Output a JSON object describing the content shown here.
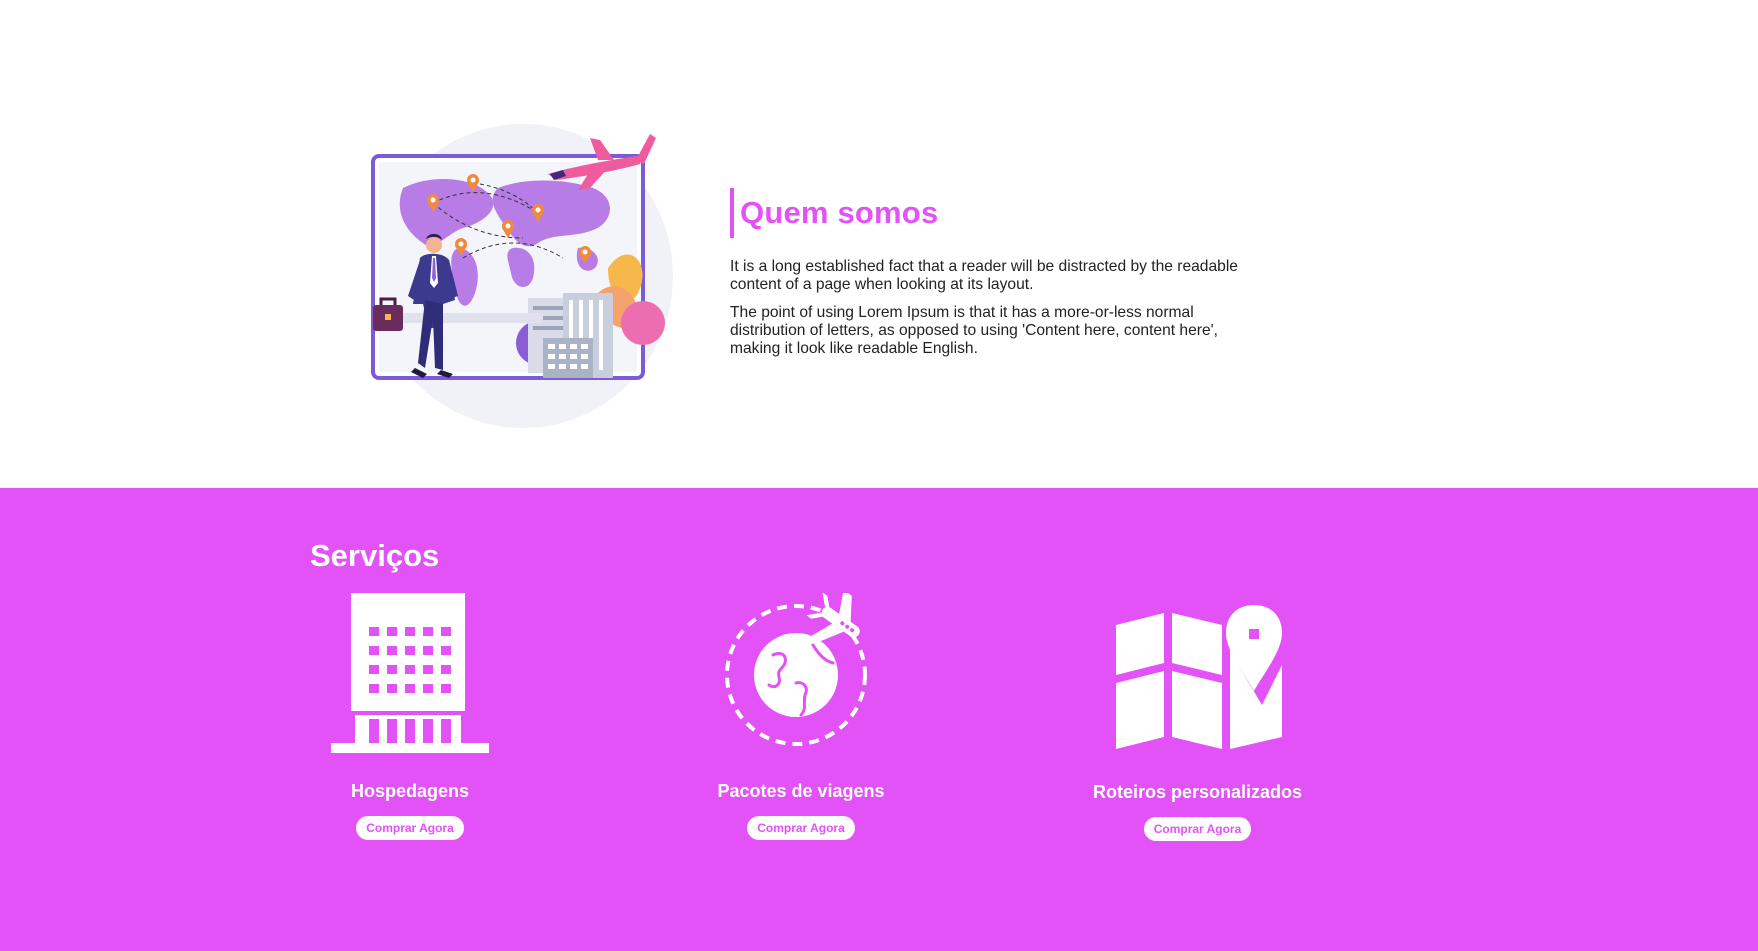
{
  "about": {
    "heading": "Quem somos",
    "paragraph1": "It is a long established fact that a reader will be distracted by the readable content of a page when looking at its layout.",
    "paragraph2": "The point of using Lorem Ipsum is that it has a more-or-less normal distribution of letters, as opposed to using 'Content here, content here', making it look like readable English.",
    "illustration": "travel-map-businessman-illustration"
  },
  "services": {
    "title": "Serviços",
    "items": [
      {
        "icon": "hotel-building-icon",
        "label": "Hospedagens",
        "button": "Comprar Agora"
      },
      {
        "icon": "globe-plane-icon",
        "label": "Pacotes de viagens",
        "button": "Comprar Agora"
      },
      {
        "icon": "map-pin-icon",
        "label": "Roteiros personalizados",
        "button": "Comprar Agora"
      }
    ]
  },
  "colors": {
    "accent": "#e252f7",
    "white": "#ffffff",
    "text": "#222222"
  }
}
